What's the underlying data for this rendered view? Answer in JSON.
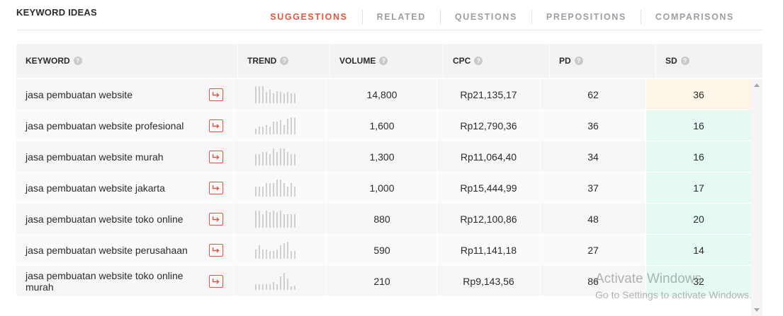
{
  "header": {
    "title": "KEYWORD IDEAS",
    "tabs": [
      {
        "label": "SUGGESTIONS",
        "active": true
      },
      {
        "label": "RELATED",
        "active": false
      },
      {
        "label": "QUESTIONS",
        "active": false
      },
      {
        "label": "PREPOSITIONS",
        "active": false
      },
      {
        "label": "COMPARISONS",
        "active": false
      }
    ]
  },
  "columns": {
    "keyword": "KEYWORD",
    "trend": "TREND",
    "volume": "VOLUME",
    "cpc": "CPC",
    "pd": "PD",
    "sd": "SD",
    "help_glyph": "?"
  },
  "colors": {
    "accent": "#e8553e",
    "sd_easy": "#e5fbf1",
    "sd_medium": "#fdf6e8",
    "spark_bar": "#cfcfcf"
  },
  "rows": [
    {
      "keyword": "jasa pembuatan website",
      "volume": "14,800",
      "cpc": "Rp21,135,17",
      "pd": "62",
      "sd": "36",
      "sd_level": "medium",
      "trend": [
        1,
        1,
        1,
        0.65,
        0.8,
        0.6,
        0.7,
        0.65,
        0.6,
        0.65,
        0.6,
        0.6
      ]
    },
    {
      "keyword": "jasa pembuatan website profesional",
      "volume": "1,600",
      "cpc": "Rp12,790,36",
      "pd": "36",
      "sd": "16",
      "sd_level": "easy",
      "trend": [
        0.35,
        0.45,
        0.45,
        0.55,
        0.45,
        0.75,
        0.75,
        0.85,
        0.55,
        0.9,
        1,
        1
      ]
    },
    {
      "keyword": "jasa pembuatan website murah",
      "volume": "1,300",
      "cpc": "Rp11,064,40",
      "pd": "34",
      "sd": "16",
      "sd_level": "easy",
      "trend": [
        0.65,
        0.65,
        0.8,
        0.8,
        0.65,
        1,
        0.8,
        1,
        1,
        0.8,
        0.65,
        0.65
      ]
    },
    {
      "keyword": "jasa pembuatan website jakarta",
      "volume": "1,000",
      "cpc": "Rp15,444,99",
      "pd": "37",
      "sd": "17",
      "sd_level": "easy",
      "trend": [
        0.6,
        0.6,
        0.6,
        0.8,
        0.8,
        0.8,
        1,
        1,
        0.8,
        0.6,
        0.8,
        0.6
      ]
    },
    {
      "keyword": "jasa pembuatan website toko online",
      "volume": "880",
      "cpc": "Rp12,100,86",
      "pd": "48",
      "sd": "20",
      "sd_level": "easy",
      "trend": [
        1,
        1,
        0.8,
        1,
        0.9,
        1,
        0.9,
        1,
        0.8,
        0.8,
        0.8,
        0.8
      ]
    },
    {
      "keyword": "jasa pembuatan website perusahaan",
      "volume": "590",
      "cpc": "Rp11,141,18",
      "pd": "27",
      "sd": "14",
      "sd_level": "easy",
      "trend": [
        0.55,
        0.8,
        0.55,
        0.55,
        0.45,
        0.45,
        0.55,
        0.8,
        0.9,
        1,
        0.45,
        0.45
      ]
    },
    {
      "keyword": "jasa pembuatan website toko online murah",
      "volume": "210",
      "cpc": "Rp9,143,56",
      "pd": "86",
      "sd": "32",
      "sd_level": "easy",
      "trend": [
        0.35,
        0.35,
        0.35,
        0.35,
        0.35,
        0.45,
        0.35,
        0.8,
        1,
        0.65,
        0.2,
        0.25
      ]
    }
  ],
  "watermark": {
    "line1": "Activate Windows",
    "line2": "Go to Settings to activate Windows."
  }
}
